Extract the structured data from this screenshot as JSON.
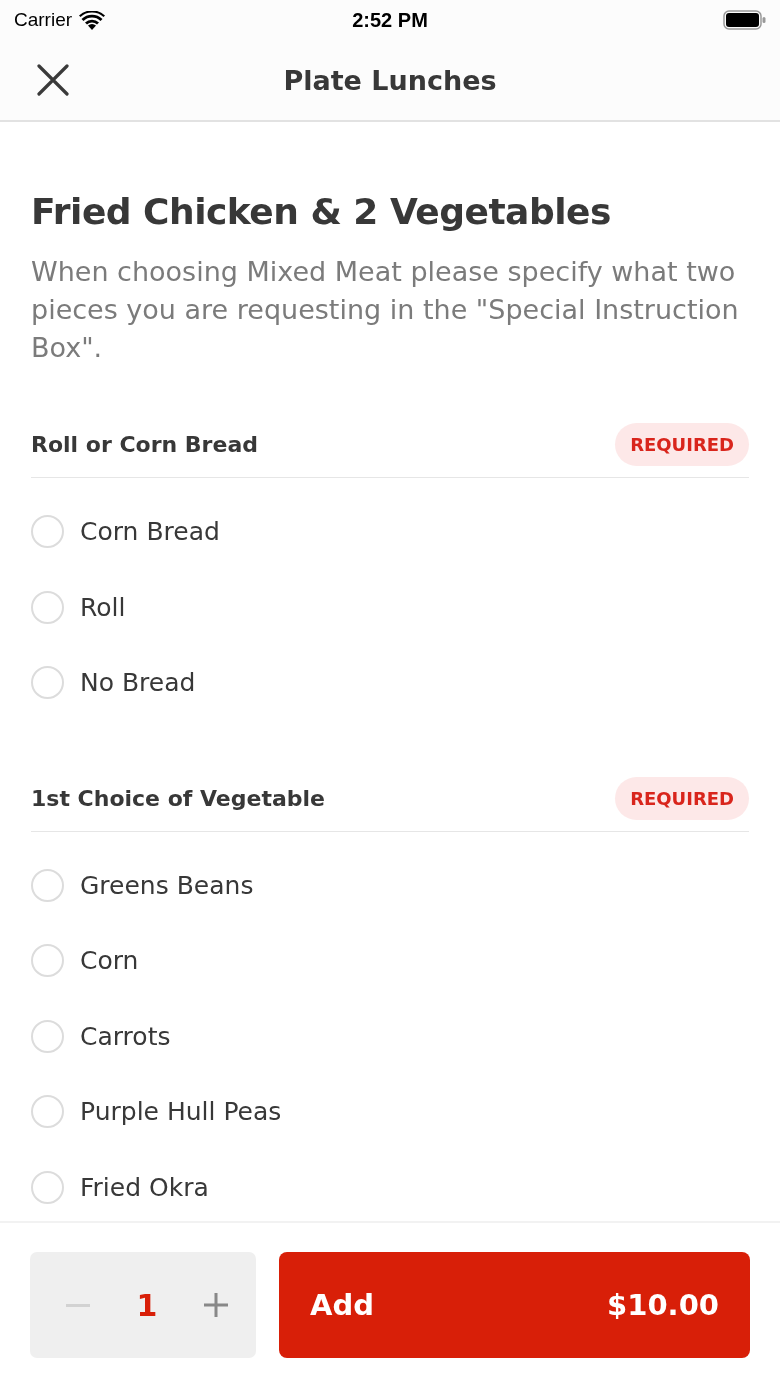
{
  "status_bar": {
    "carrier": "Carrier",
    "time": "2:52 PM"
  },
  "header": {
    "title": "Plate Lunches"
  },
  "item": {
    "name": "Fried Chicken & 2 Vegetables",
    "description": "When choosing Mixed Meat please specify what two pieces you are requesting in the \"Special Instruction Box\"."
  },
  "option_groups": [
    {
      "title": "Roll or Corn Bread",
      "badge": "REQUIRED",
      "options": [
        {
          "label": "Corn Bread",
          "selected": false
        },
        {
          "label": "Roll",
          "selected": false
        },
        {
          "label": "No Bread",
          "selected": false
        }
      ]
    },
    {
      "title": "1st Choice of Vegetable",
      "badge": "REQUIRED",
      "options": [
        {
          "label": "Greens Beans",
          "selected": false
        },
        {
          "label": "Corn",
          "selected": false
        },
        {
          "label": "Carrots",
          "selected": false
        },
        {
          "label": "Purple Hull Peas",
          "selected": false
        },
        {
          "label": "Fried Okra",
          "selected": false
        }
      ]
    }
  ],
  "footer": {
    "quantity": "1",
    "decrement_disabled": true,
    "add_label": "Add",
    "price": "$10.00"
  }
}
